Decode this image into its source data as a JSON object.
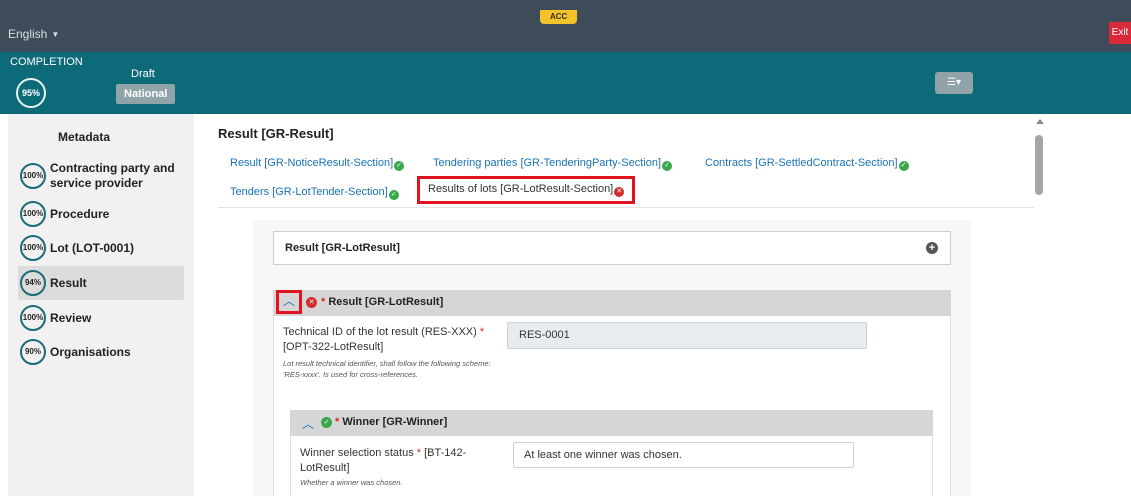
{
  "topbar": {
    "language": "English",
    "environment": "ACC",
    "exit_label": "Exit"
  },
  "band": {
    "completion_label": "COMPLETION",
    "completion_percent": "95%",
    "status": "Draft",
    "scope": "National",
    "settings_icon": "sliders-icon"
  },
  "sidebar": {
    "title": "Metadata",
    "items": [
      {
        "percent": "100%",
        "label": "Contracting party and service provider"
      },
      {
        "percent": "100%",
        "label": "Procedure"
      },
      {
        "percent": "100%",
        "label": "Lot (LOT-0001)"
      },
      {
        "percent": "94%",
        "label": "Result",
        "active": true
      },
      {
        "percent": "100%",
        "label": "Review"
      },
      {
        "percent": "90%",
        "label": "Organisations"
      }
    ]
  },
  "main": {
    "title": "Result [GR-Result]",
    "tabs": [
      {
        "label": "Result  [GR-NoticeResult-Section]",
        "status": "ok"
      },
      {
        "label": "Tendering parties  [GR-TenderingParty-Section]",
        "status": "ok"
      },
      {
        "label": "Contracts  [GR-SettledContract-Section]",
        "status": "ok"
      },
      {
        "label": "Tenders  [GR-LotTender-Section]",
        "status": "ok"
      },
      {
        "label": "Results of lots  [GR-LotResult-Section]",
        "status": "error",
        "active": true
      }
    ],
    "result_card_label": "Result  [GR-LotResult]",
    "section": {
      "title": "Result  [GR-LotResult]",
      "required_mark": "*",
      "field": {
        "label": "Technical ID of the lot result (RES-XXX)",
        "required_mark": "*",
        "code": "[OPT-322-LotResult]",
        "help": "Lot result technical identifier, shall follow the following scheme: 'RES-xxxx'. Is used for cross-references.",
        "value": "RES-0001"
      },
      "winner": {
        "title": "Winner  [GR-Winner]",
        "required_mark": "*",
        "field_label": "Winner selection status",
        "required": "*",
        "code": "[BT-142-LotResult]",
        "help": "Whether a winner was chosen.",
        "value": "At least one winner was chosen."
      }
    }
  },
  "colors": {
    "topbar": "#3d4c58",
    "band": "#0d6a78",
    "link": "#1a73b5",
    "highlight": "#e0141e",
    "ok": "#38a84a",
    "error": "#d22d2d"
  }
}
